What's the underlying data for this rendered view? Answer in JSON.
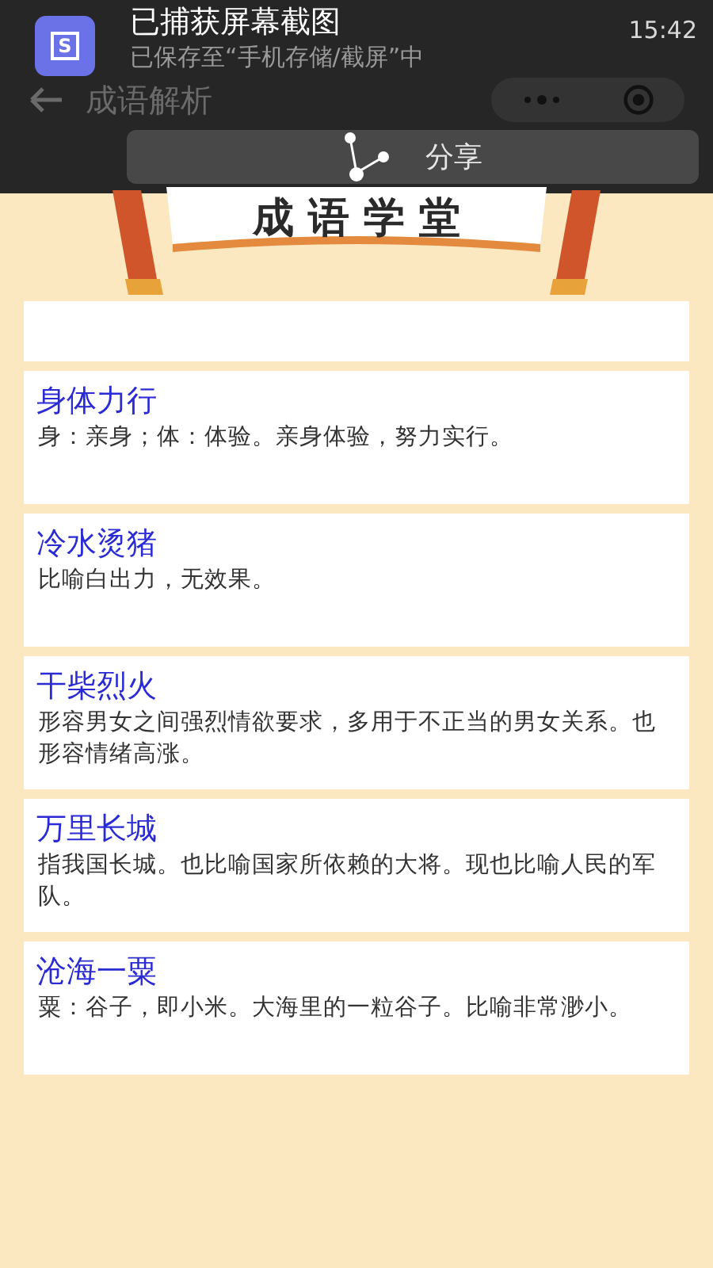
{
  "notification": {
    "title": "已捕获屏幕截图",
    "subtitle": "已保存至“手机存储/截屏”中",
    "time": "15:42",
    "icon_letter": "S"
  },
  "header": {
    "title": "成语解析"
  },
  "share_button": {
    "label": "分享"
  },
  "banner": {
    "title": "成 语 学 堂"
  },
  "idioms": [
    {
      "kind": "clipped"
    },
    {
      "kind": "idiom",
      "title": "身体力行",
      "definition": "身：亲身；体：体验。亲身体验，努力实行。"
    },
    {
      "kind": "idiom",
      "title": "冷水烫猪",
      "definition": "比喻白出力，无效果。"
    },
    {
      "kind": "idiom",
      "title": "干柴烈火",
      "definition": "形容男女之间强烈情欲要求，多用于不正当的男女关系。也形容情绪高涨。"
    },
    {
      "kind": "idiom",
      "title": "万里长城",
      "definition": "指我国长城。也比喻国家所依赖的大将。现也比喻人民的军队。"
    },
    {
      "kind": "idiom",
      "title": "沧海一粟",
      "definition": "粟：谷子，即小米。大海里的一粒谷子。比喻非常渺小。"
    }
  ]
}
